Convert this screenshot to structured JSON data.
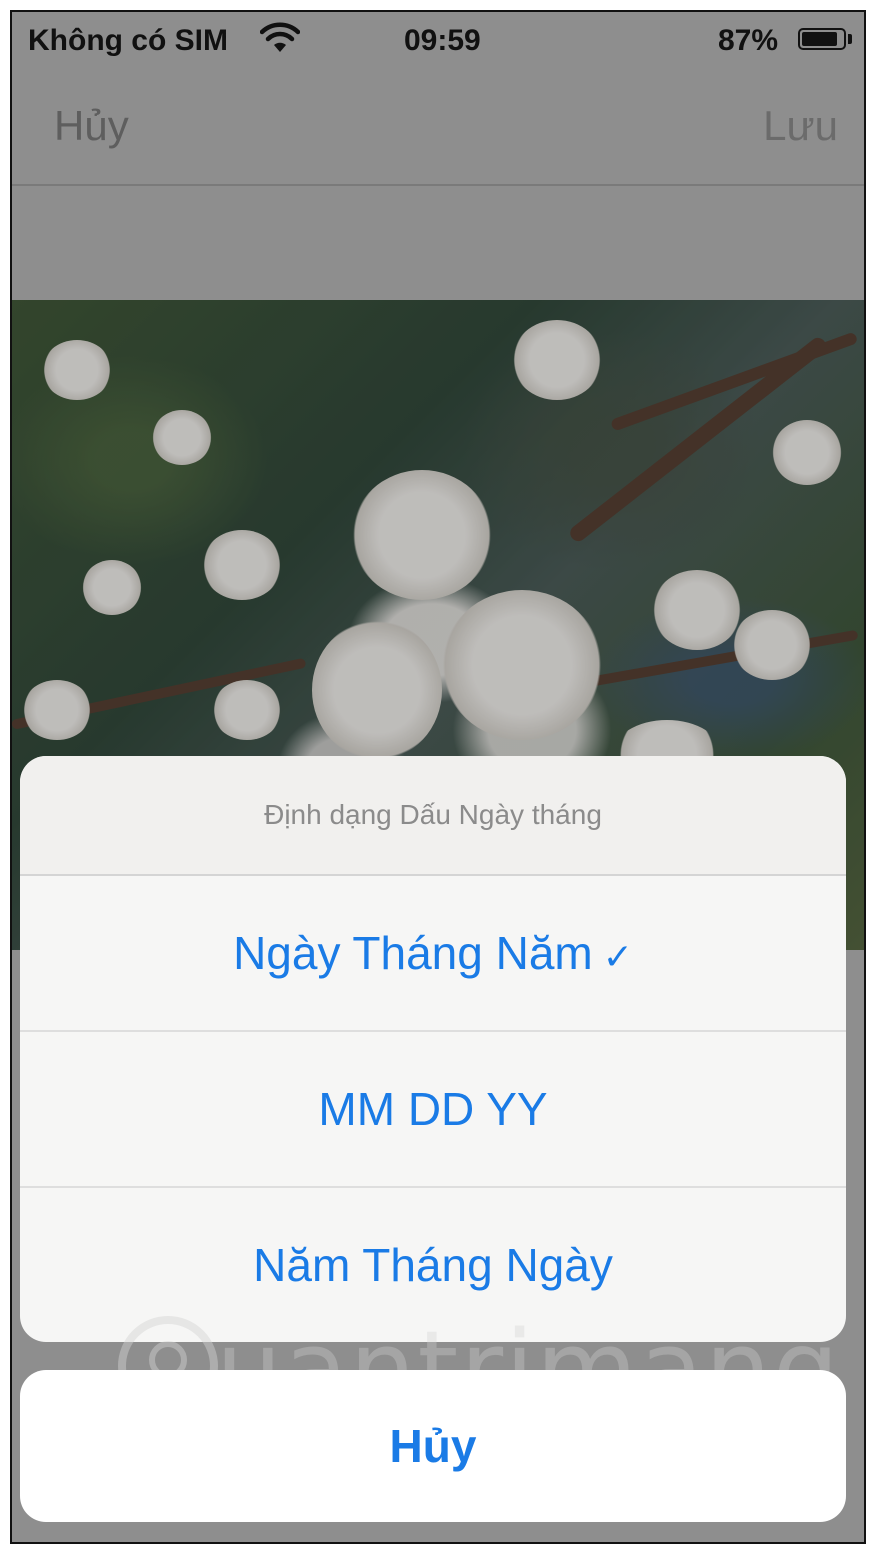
{
  "status_bar": {
    "carrier": "Không có SIM",
    "time": "09:59",
    "battery": "87%",
    "battery_level": 0.87,
    "wifi_icon": "wifi-icon"
  },
  "nav": {
    "cancel_label": "Hủy",
    "save_label": "Lưu"
  },
  "photo": {
    "description_icon": "cherry-blossom-photo"
  },
  "action_sheet": {
    "title": "Định dạng Dấu Ngày tháng",
    "options": [
      {
        "label": "Ngày Tháng Năm",
        "selected": true
      },
      {
        "label": "MM DD YY",
        "selected": false
      },
      {
        "label": "Năm Tháng Ngày",
        "selected": false
      }
    ],
    "check_glyph": "✓",
    "cancel_label": "Hủy"
  },
  "watermark": {
    "text": "uantrimang"
  },
  "colors": {
    "accent": "#1a7be6",
    "dim_overlay": "#8e8e8e",
    "sheet_bg": "#f6f6f5"
  }
}
